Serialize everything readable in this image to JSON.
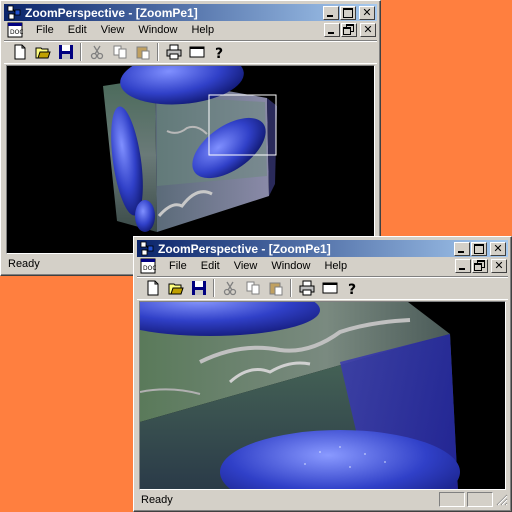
{
  "windows": [
    {
      "title": "ZoomPerspective - [ZoomPe1]",
      "menu": [
        "File",
        "Edit",
        "View",
        "Window",
        "Help"
      ],
      "toolbar_icons": [
        "new-icon",
        "open-icon",
        "save-icon",
        "cut-icon",
        "copy-icon",
        "paste-icon",
        "print-icon",
        "window-icon",
        "help-icon"
      ],
      "status": "Ready",
      "view": "3d-cube-with-zoom-rectangle"
    },
    {
      "title": "ZoomPerspective - [ZoomPe1]",
      "menu": [
        "File",
        "Edit",
        "View",
        "Window",
        "Help"
      ],
      "toolbar_icons": [
        "new-icon",
        "open-icon",
        "save-icon",
        "cut-icon",
        "copy-icon",
        "paste-icon",
        "print-icon",
        "window-icon",
        "help-icon"
      ],
      "status": "Ready",
      "view": "zoomed-cube-detail"
    }
  ],
  "colors": {
    "desktop": "#ff7f3f",
    "title_active_start": "#0a246a",
    "title_active_end": "#a6caf0",
    "face": "#d4d0c8",
    "berry_blue": "#3040c8"
  }
}
